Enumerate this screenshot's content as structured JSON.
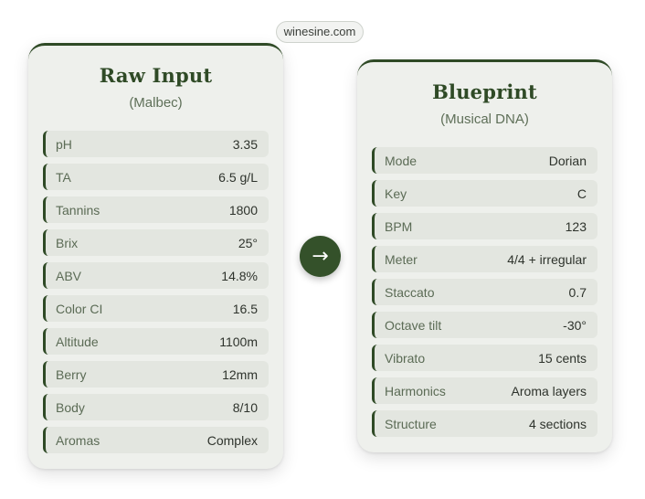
{
  "source": "winesine.com",
  "arrow_glyph": "→",
  "colors": {
    "accent": "#2f4a26",
    "card": "#eef0ec",
    "row": "#e3e6e0"
  },
  "raw_input": {
    "title": "Raw Input",
    "subtitle": "(Malbec)",
    "rows": [
      {
        "label": "pH",
        "value": "3.35"
      },
      {
        "label": "TA",
        "value": "6.5 g/L"
      },
      {
        "label": "Tannins",
        "value": "1800"
      },
      {
        "label": "Brix",
        "value": "25°"
      },
      {
        "label": "ABV",
        "value": "14.8%"
      },
      {
        "label": "Color CI",
        "value": "16.5"
      },
      {
        "label": "Altitude",
        "value": "1100m"
      },
      {
        "label": "Berry",
        "value": "12mm"
      },
      {
        "label": "Body",
        "value": "8/10"
      },
      {
        "label": "Aromas",
        "value": "Complex"
      }
    ]
  },
  "blueprint": {
    "title": "Blueprint",
    "subtitle": "(Musical DNA)",
    "rows": [
      {
        "label": "Mode",
        "value": "Dorian"
      },
      {
        "label": "Key",
        "value": "C"
      },
      {
        "label": "BPM",
        "value": "123"
      },
      {
        "label": "Meter",
        "value": "4/4 + irregular"
      },
      {
        "label": "Staccato",
        "value": "0.7"
      },
      {
        "label": "Octave tilt",
        "value": "-30°"
      },
      {
        "label": "Vibrato",
        "value": "15 cents"
      },
      {
        "label": "Harmonics",
        "value": "Aroma layers"
      },
      {
        "label": "Structure",
        "value": "4 sections"
      }
    ]
  }
}
